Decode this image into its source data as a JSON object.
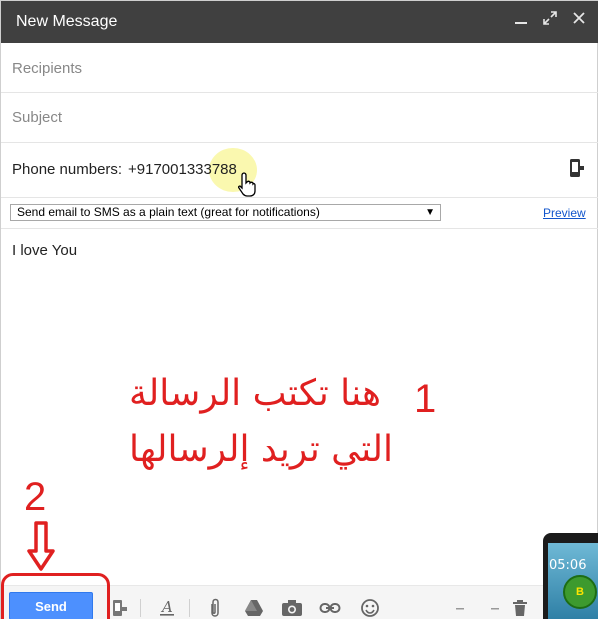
{
  "window": {
    "title": "New Message"
  },
  "fields": {
    "recipients_placeholder": "Recipients",
    "subject_placeholder": "Subject",
    "phone_label": "Phone numbers:",
    "phone_value": "+917001333788"
  },
  "mode": {
    "selected": "Send email to SMS as a plain text (great for notifications)",
    "preview_label": "Preview"
  },
  "message": {
    "body": "I love You"
  },
  "annotations": {
    "step1_number": "1",
    "step1_line1": "هنا تكتب الرسالة",
    "step1_line2": "التي تريد إلرسالها",
    "step2_number": "2",
    "color": "#e02020"
  },
  "toolbar": {
    "send_label": "Send",
    "icons": [
      "sms-icon",
      "format-text-icon",
      "attach-icon",
      "drive-icon",
      "camera-icon",
      "link-icon",
      "emoji-icon",
      "more-icon",
      "trash-icon"
    ]
  },
  "overlay": {
    "phone_time": "05:06",
    "logo_letter": "B"
  },
  "colors": {
    "titlebar": "#404040",
    "send_button": "#4d90fe",
    "link": "#1155cc",
    "highlight": "#f6f36e"
  }
}
